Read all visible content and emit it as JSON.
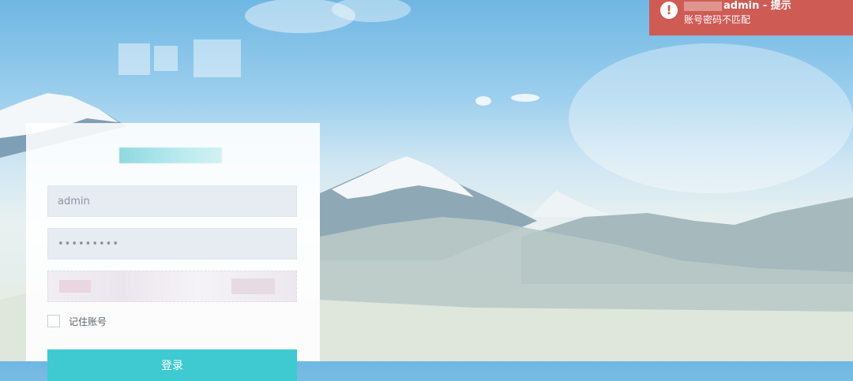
{
  "notification": {
    "title": "admin - 提示",
    "message": "账号密码不匹配",
    "icon": "alert-shield-icon",
    "color": "#cf5b55"
  },
  "login": {
    "username_value": "admin",
    "password_value": "•••••••••",
    "remember_label": "记住账号",
    "button_label": "登录",
    "accent_color": "#3ecad0"
  }
}
